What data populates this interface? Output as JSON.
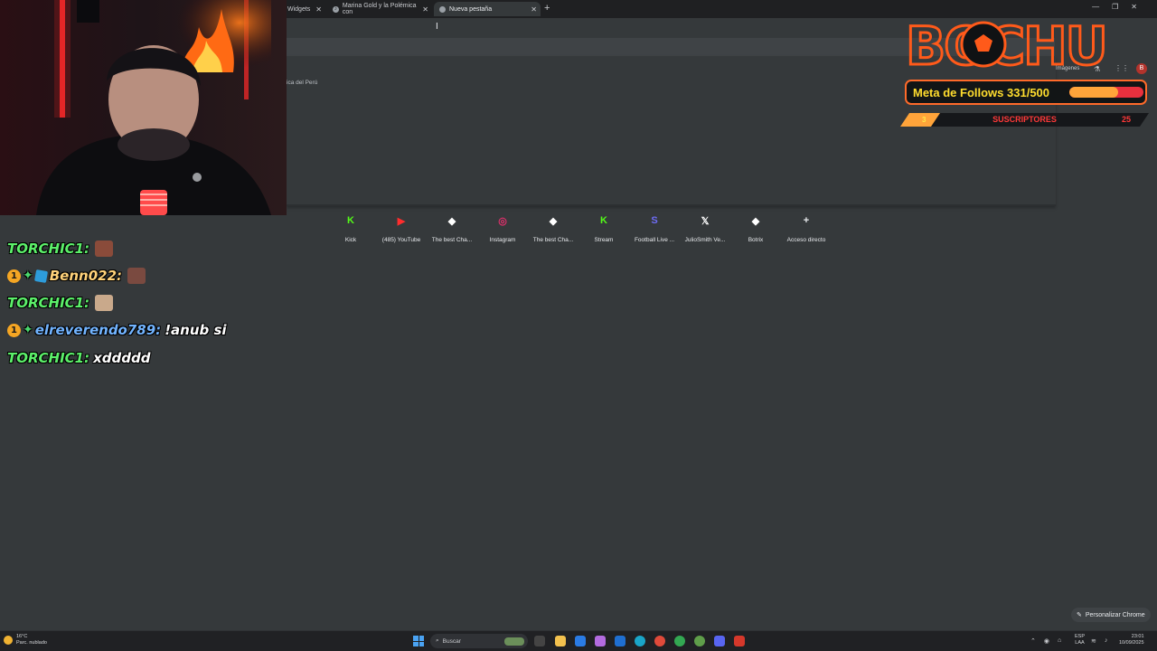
{
  "browser": {
    "tabs": [
      {
        "label": "Widgets",
        "icon": "widget-icon"
      },
      {
        "label": "Marina Gold y la Polémica con",
        "icon": "tiktok-icon"
      },
      {
        "label": "Nueva pestaña",
        "icon": "chrome-icon",
        "active": true
      }
    ],
    "fragment_text": "ica del Perú",
    "right_links": {
      "imagenes": "Imágenes"
    },
    "profile_initial": "B",
    "customize_label": "Personalizar Chrome"
  },
  "shortcuts": [
    {
      "label": "Kick",
      "icon": "kick-icon",
      "glyph": "K",
      "color": "#53fc18"
    },
    {
      "label": "(485) YouTube",
      "icon": "youtube-icon",
      "glyph": "▶",
      "color": "#ff2d2d"
    },
    {
      "label": "The best Cha...",
      "icon": "diamond-icon",
      "glyph": "◆",
      "color": "#ffffff"
    },
    {
      "label": "Instagram",
      "icon": "instagram-icon",
      "glyph": "◎",
      "color": "#e1306c"
    },
    {
      "label": "The best Cha...",
      "icon": "diamond-icon",
      "glyph": "◆",
      "color": "#ffffff"
    },
    {
      "label": "Stream",
      "icon": "kick-icon",
      "glyph": "K",
      "color": "#53fc18"
    },
    {
      "label": "Football Live ...",
      "icon": "football-live-icon",
      "glyph": "S",
      "color": "#6e6cf5"
    },
    {
      "label": "JulioSmith Ve...",
      "icon": "x-icon",
      "glyph": "𝕏",
      "color": "#ffffff"
    },
    {
      "label": "Botrix",
      "icon": "diamond-icon",
      "glyph": "◆",
      "color": "#ffffff"
    },
    {
      "label": "Acceso directo",
      "icon": "plus-icon",
      "glyph": "+",
      "color": "#e8eaed"
    }
  ],
  "chat": {
    "messages": [
      {
        "user": "TORCHIC1:",
        "user_color": "#5cf06a",
        "text": "",
        "emote": "#8a4b3a",
        "badges": false
      },
      {
        "user": "Benn022:",
        "user_color": "#ffd27a",
        "text": "",
        "emote": "#7a4a40",
        "badges": true,
        "cube": true
      },
      {
        "user": "TORCHIC1:",
        "user_color": "#5cf06a",
        "text": "",
        "emote": "#c9a98b",
        "badges": false
      },
      {
        "user": "elreverendo789:",
        "user_color": "#72b4ff",
        "text": "!anub si",
        "emote": null,
        "badges": true,
        "cube": false
      },
      {
        "user": "TORCHIC1:",
        "user_color": "#5cf06a",
        "text": "xddddd",
        "emote": null,
        "badges": false
      }
    ]
  },
  "overlay": {
    "brand": "BOCHU",
    "follows_label": "Meta de Follows 331/500",
    "follows_current": 331,
    "follows_goal": 500,
    "subs_label": "SUSCRIPTORES",
    "subs_left": "3",
    "subs_right": "25"
  },
  "taskbar": {
    "weather_temp": "16°C",
    "weather_desc": "Parc. nublado",
    "search_placeholder": "Buscar",
    "lang_line1": "ESP",
    "lang_line2": "LAA",
    "time": "23:01",
    "date": "10/09/2025"
  }
}
